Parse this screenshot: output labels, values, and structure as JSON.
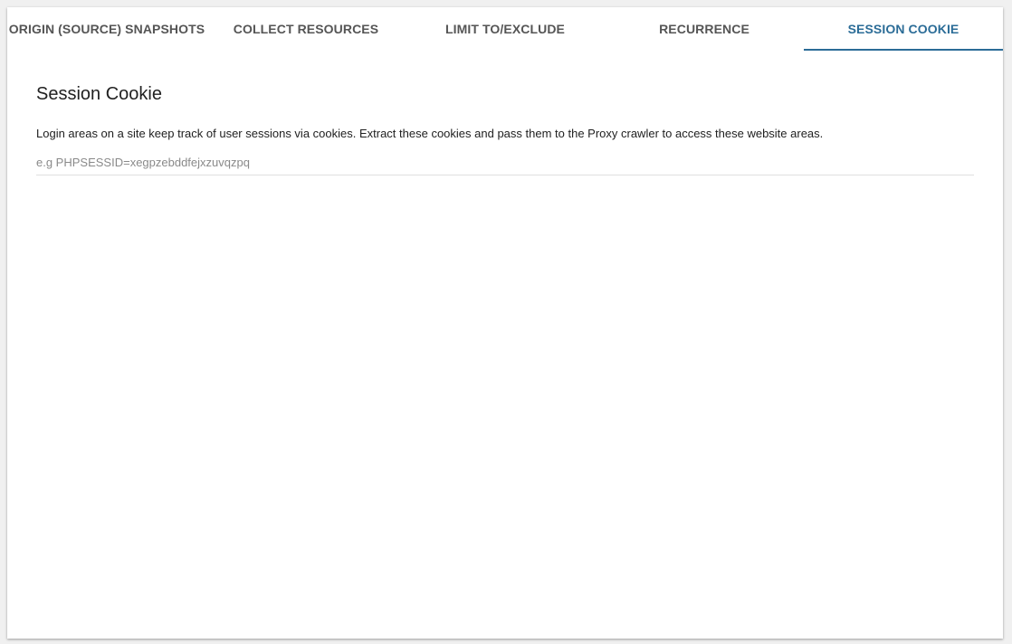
{
  "tabs": [
    {
      "label": "ORIGIN (SOURCE) SNAPSHOTS",
      "active": false
    },
    {
      "label": "COLLECT RESOURCES",
      "active": false
    },
    {
      "label": "LIMIT TO/EXCLUDE",
      "active": false
    },
    {
      "label": "RECURRENCE",
      "active": false
    },
    {
      "label": "SESSION COOKIE",
      "active": true
    }
  ],
  "section": {
    "title": "Session Cookie",
    "description": "Login areas on a site keep track of user sessions via cookies. Extract these cookies and pass them to the Proxy crawler to access these website areas.",
    "input_value": "",
    "input_placeholder": "e.g PHPSESSID=xegpzebddfejxzuvqzpq"
  },
  "colors": {
    "accent": "#2b6c97",
    "tab_text": "#555555",
    "background": "#f0f0f0",
    "card": "#ffffff"
  }
}
